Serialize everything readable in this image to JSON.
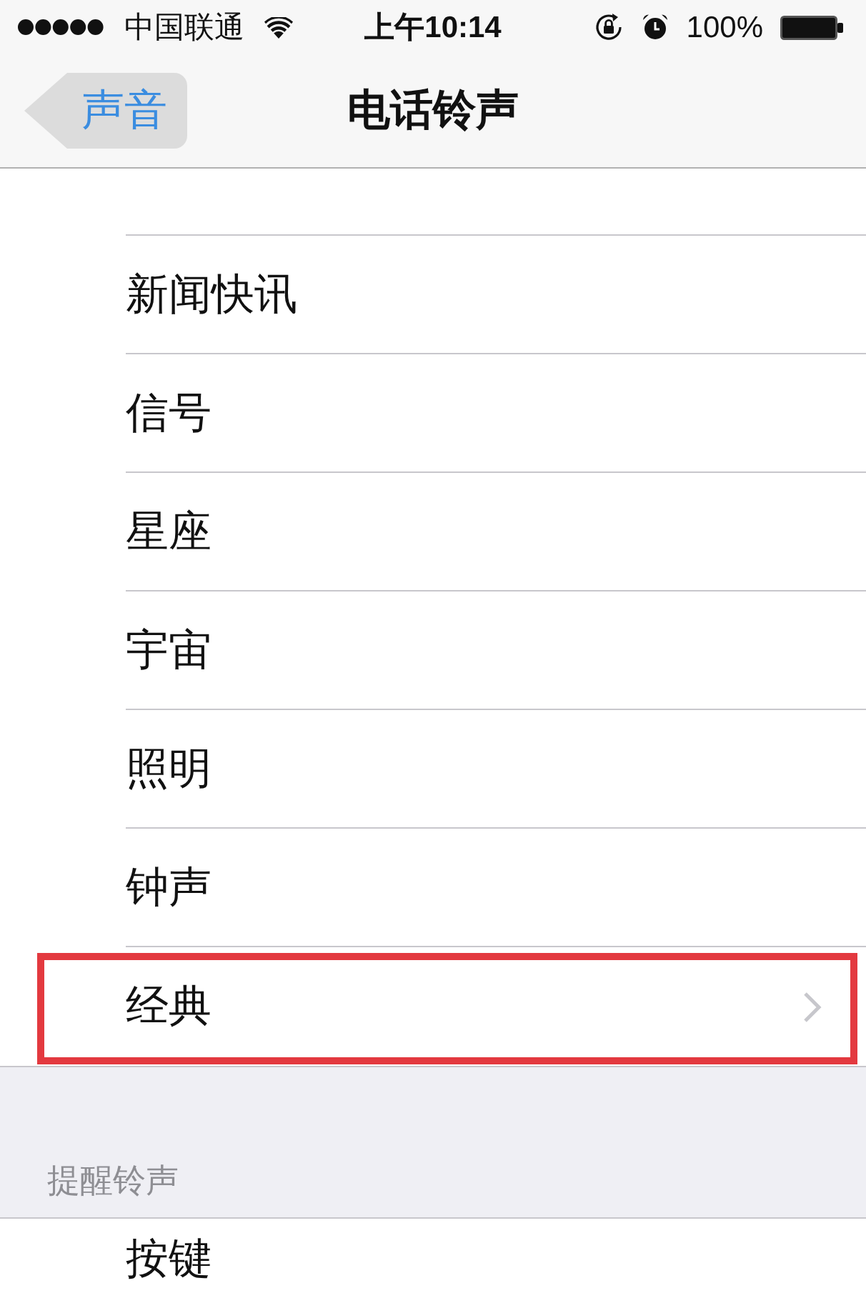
{
  "status_bar": {
    "carrier": "中国联通",
    "time": "上午10:14",
    "battery": "100%"
  },
  "nav_bar": {
    "back": "声音",
    "title": "电话铃声"
  },
  "ringtones": [
    {
      "label": "新闻快讯",
      "disclosure": false,
      "highlighted": false
    },
    {
      "label": "信号",
      "disclosure": false,
      "highlighted": false
    },
    {
      "label": "星座",
      "disclosure": false,
      "highlighted": false
    },
    {
      "label": "宇宙",
      "disclosure": false,
      "highlighted": false
    },
    {
      "label": "照明",
      "disclosure": false,
      "highlighted": false
    },
    {
      "label": "钟声",
      "disclosure": false,
      "highlighted": false
    },
    {
      "label": "经典",
      "disclosure": true,
      "highlighted": true
    }
  ],
  "sections": [
    {
      "header": "提醒铃声",
      "items": [
        {
          "label": "按键"
        }
      ]
    }
  ]
}
